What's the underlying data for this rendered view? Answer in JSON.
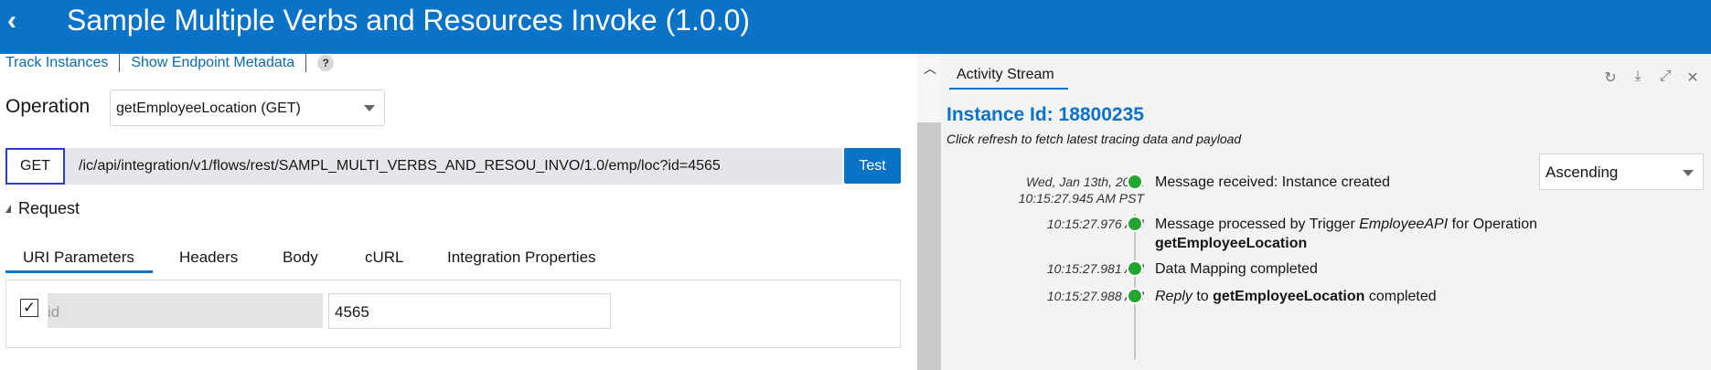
{
  "header": {
    "back_icon": "chevron-left-icon",
    "title": "Sample Multiple Verbs and Resources Invoke (1.0.0)",
    "color": "#0a72c7"
  },
  "links": {
    "track": "Track Instances",
    "metadata": "Show Endpoint Metadata",
    "help": "?"
  },
  "operation": {
    "label": "Operation",
    "selected": "getEmployeeLocation (GET)"
  },
  "request_line": {
    "method": "GET",
    "url": "/ic/api/integration/v1/flows/rest/SAMPL_MULTI_VERBS_AND_RESOU_INVO/1.0/emp/loc?id=4565",
    "test_label": "Test"
  },
  "request": {
    "label": "Request"
  },
  "tabs": [
    "URI Parameters",
    "Headers",
    "Body",
    "cURL",
    "Integration Properties"
  ],
  "params": [
    {
      "checked": true,
      "name": "id",
      "value": "4565"
    }
  ],
  "activity": {
    "tab_label": "Activity Stream",
    "instance_title": "Instance Id: 18800235",
    "subtitle": "Click refresh to fetch latest tracing data and payload",
    "sort": "Ascending",
    "tools": [
      "refresh-icon",
      "download-icon",
      "expand-icon",
      "close-icon"
    ],
    "events": [
      {
        "time1": "Wed, Jan 13th, 2021",
        "time2": "10:15:27.945 AM PST",
        "parts": [
          {
            "t": "Message received: Instance created",
            "s": "n"
          }
        ]
      },
      {
        "time1": "10:15:27.976 AM",
        "time2": "",
        "parts": [
          {
            "t": "Message processed by Trigger ",
            "s": "n"
          },
          {
            "t": "EmployeeAPI",
            "s": "i"
          },
          {
            "t": " for Operation",
            "s": "n"
          }
        ],
        "line2": "getEmployeeLocation"
      },
      {
        "time1": "10:15:27.981 AM",
        "time2": "",
        "parts": [
          {
            "t": "Data Mapping completed",
            "s": "n"
          }
        ]
      },
      {
        "time1": "10:15:27.988 AM",
        "time2": "",
        "parts": [
          {
            "t": "Reply",
            "s": "i"
          },
          {
            "t": " to ",
            "s": "n"
          },
          {
            "t": "getEmployeeLocation",
            "s": "b"
          },
          {
            "t": " completed",
            "s": "n"
          }
        ]
      }
    ],
    "status_color": "#26a432"
  }
}
